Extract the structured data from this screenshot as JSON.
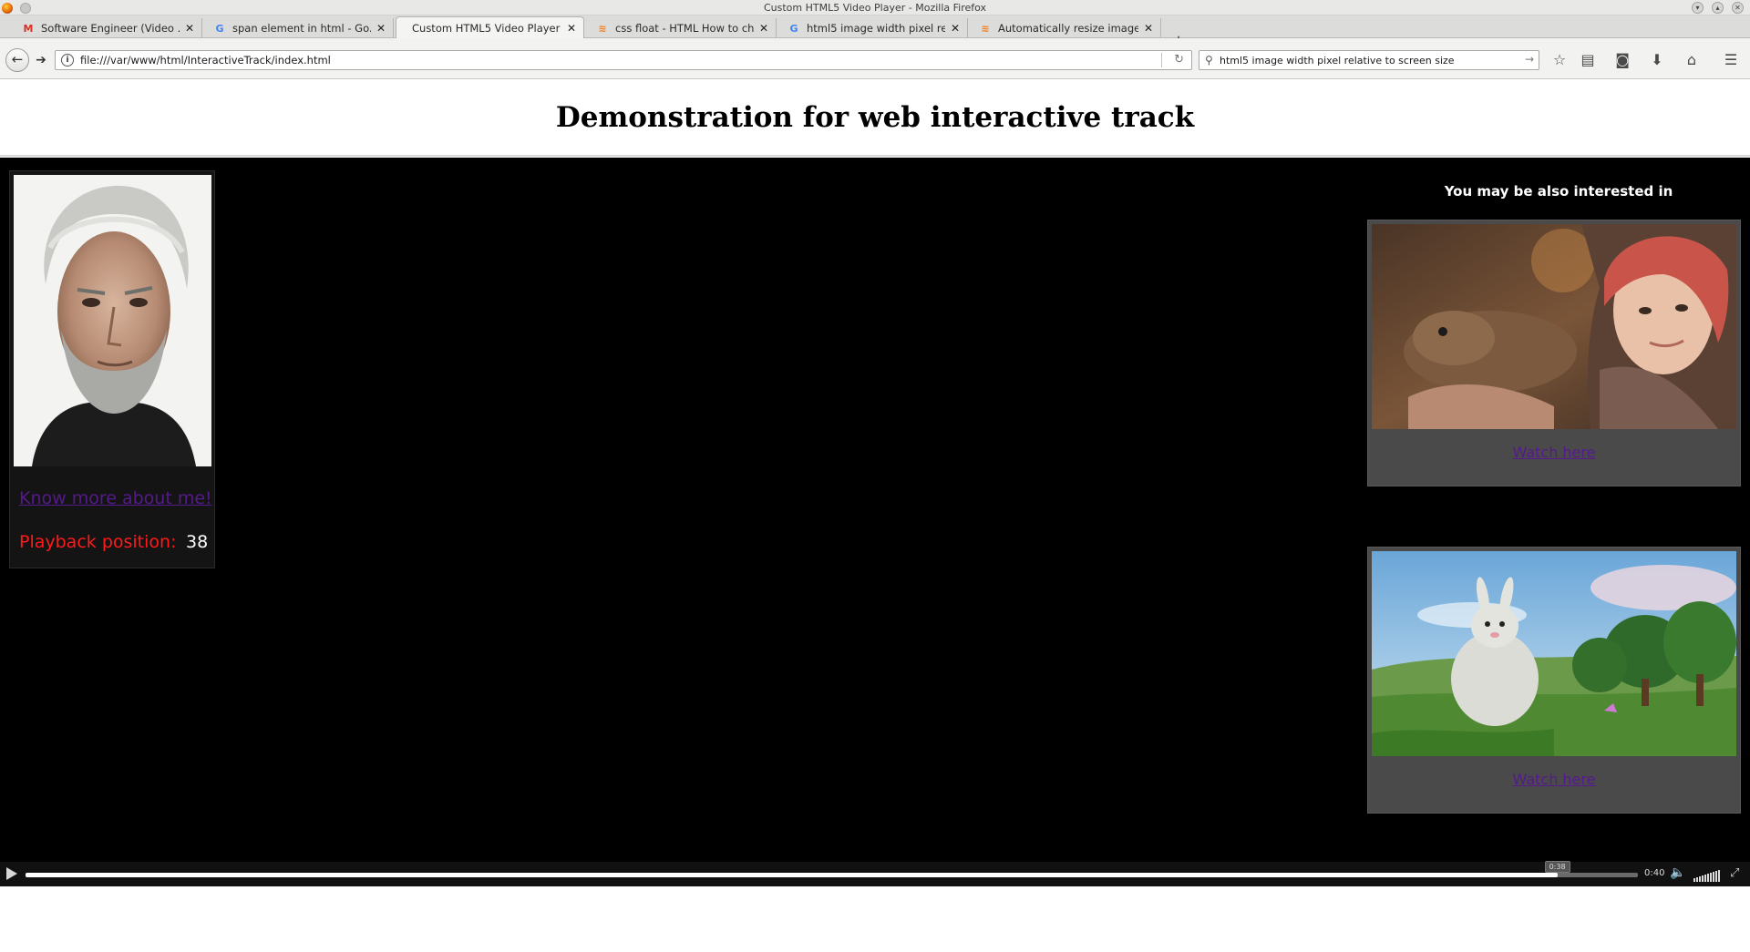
{
  "window": {
    "title": "Custom HTML5 Video Player - Mozilla Firefox"
  },
  "tabs": [
    {
      "label": "Software Engineer (Video ...",
      "icon": "gmail-icon"
    },
    {
      "label": "span element in html - Go...",
      "icon": "google-icon"
    },
    {
      "label": "Custom HTML5 Video Player",
      "icon": "none",
      "active": true
    },
    {
      "label": "css float - HTML How to ch...",
      "icon": "stackoverflow-icon"
    },
    {
      "label": "html5 image width pixel re...",
      "icon": "google-icon"
    },
    {
      "label": "Automatically resize image...",
      "icon": "stackoverflow-icon"
    }
  ],
  "nav": {
    "url": "file:///var/www/html/InteractiveTrack/index.html",
    "search_query": "html5 image width pixel relative to screen size"
  },
  "page": {
    "heading": "Demonstration for web interactive track",
    "info": {
      "link": "Know more about me!",
      "position_label": "Playback position:",
      "position_value": "38"
    },
    "suggestions": {
      "title": "You may be also interested in",
      "items": [
        {
          "link": "Watch here"
        },
        {
          "link": "Watch here"
        }
      ]
    }
  },
  "player": {
    "current_time_tooltip": "0:38",
    "duration": "0:40",
    "progress_fraction": 0.95
  },
  "colors": {
    "link": "#551a8b",
    "position_label": "#ff1a1a",
    "stage_bg": "#000000"
  }
}
